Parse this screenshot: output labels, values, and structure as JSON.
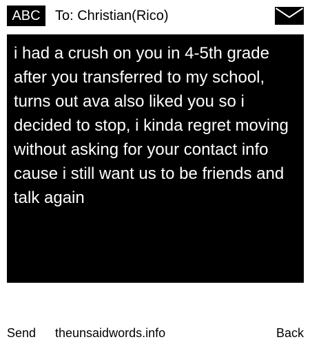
{
  "header": {
    "mode_label": "ABC",
    "recipient": "To: Christian(Rico)",
    "envelope_icon": "envelope-icon"
  },
  "message": {
    "text": "i had a crush on you in 4-5th grade after you transferred to my school, turns out ava also liked you so i decided to stop, i kinda regret moving without asking for your contact info cause i still want us to be friends and talk again"
  },
  "softkeys": {
    "left": "Send",
    "center": "theunsaidwords.info",
    "right": "Back"
  },
  "colors": {
    "background": "#ffffff",
    "message_background": "#000000",
    "message_text": "#ffffff",
    "text": "#000000"
  }
}
